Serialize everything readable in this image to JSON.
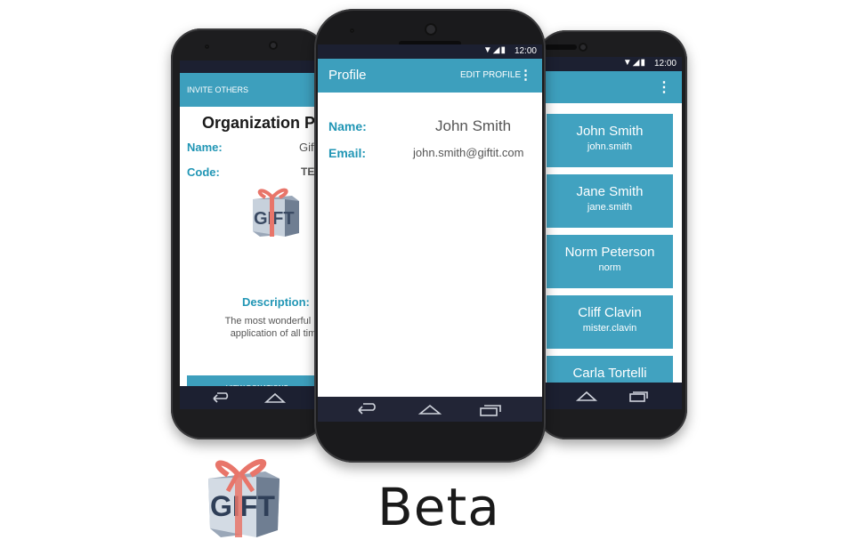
{
  "left_phone": {
    "toolbar_action": "INVITE OTHERS",
    "heading": "Organization Pr",
    "name_label": "Name:",
    "name_value": "Giftit",
    "code_label": "Code:",
    "code_value": "TES",
    "description_label": "Description:",
    "description_text": "The most wonderful m application of all tim",
    "view_donations_button": "VIEW DONATIONS"
  },
  "center_phone": {
    "status_time": "12:00",
    "toolbar_title": "Profile",
    "edit_profile_button": "EDIT PROFILE",
    "name_label": "Name:",
    "name_value": "John Smith",
    "email_label": "Email:",
    "email_value": "john.smith@giftit.com"
  },
  "right_phone": {
    "status_time": "12:00",
    "users": [
      {
        "name": "John Smith",
        "username": "john.smith"
      },
      {
        "name": "Jane Smith",
        "username": "jane.smith"
      },
      {
        "name": "Norm Peterson",
        "username": "norm"
      },
      {
        "name": "Cliff Clavin",
        "username": "mister.clavin"
      },
      {
        "name": "Carla Tortelli",
        "username": ""
      }
    ]
  },
  "logo": {
    "text": "GIFT IT"
  },
  "caption": "Beta",
  "colors": {
    "accent": "#3d9fbd",
    "label": "#2196b5",
    "bars": "#1c2031",
    "bow": "#e8756a"
  }
}
